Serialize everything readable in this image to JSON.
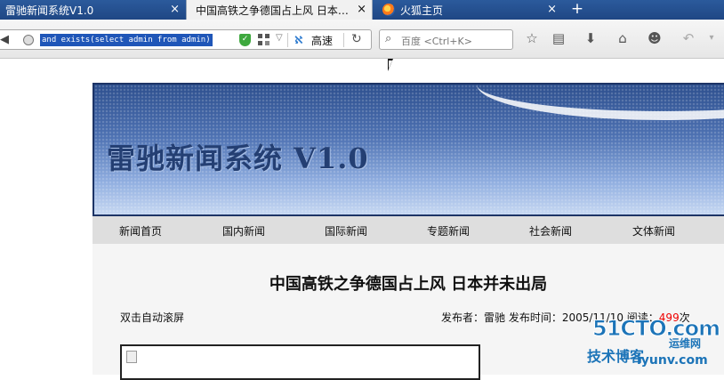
{
  "tabs": [
    {
      "title": "雷驰新闻系统V1.0",
      "close": "×",
      "active": false
    },
    {
      "title": "中国高铁之争德国占上风 日本…",
      "close": "×",
      "active": true
    },
    {
      "title": "火狐主页",
      "close": "×",
      "active": false
    }
  ],
  "new_tab": "+",
  "urlbar": {
    "back_glyph": "◀",
    "url": "and exists(select admin from admin)",
    "shield_glyph": "✓",
    "speed_label": "高速",
    "reload_glyph": "↻"
  },
  "search": {
    "placeholder": "百度 <Ctrl+K>"
  },
  "toolbar": {
    "icons": [
      "bookmark-star-icon",
      "reading-list-icon",
      "download-icon",
      "home-icon",
      "chat-icon",
      "undo-icon",
      "more-dropdown-icon"
    ]
  },
  "site": {
    "banner_title": "雷驰新闻系统 V1.0",
    "menu": [
      "新闻首页",
      "国内新闻",
      "国际新闻",
      "专题新闻",
      "社会新闻",
      "文体新闻"
    ]
  },
  "article": {
    "title": "中国高铁之争德国占上风 日本并未出局",
    "scroll_hint": "双击自动滚屏",
    "meta_prefix": "发布者：雷驰 发布时间：2005/11/10 阅读：",
    "read_count": "499",
    "read_suffix": "次"
  },
  "watermark": {
    "big": "51CTO.com",
    "ops": "运维网",
    "sub": "技术博客",
    "site": "iyunv.com"
  }
}
